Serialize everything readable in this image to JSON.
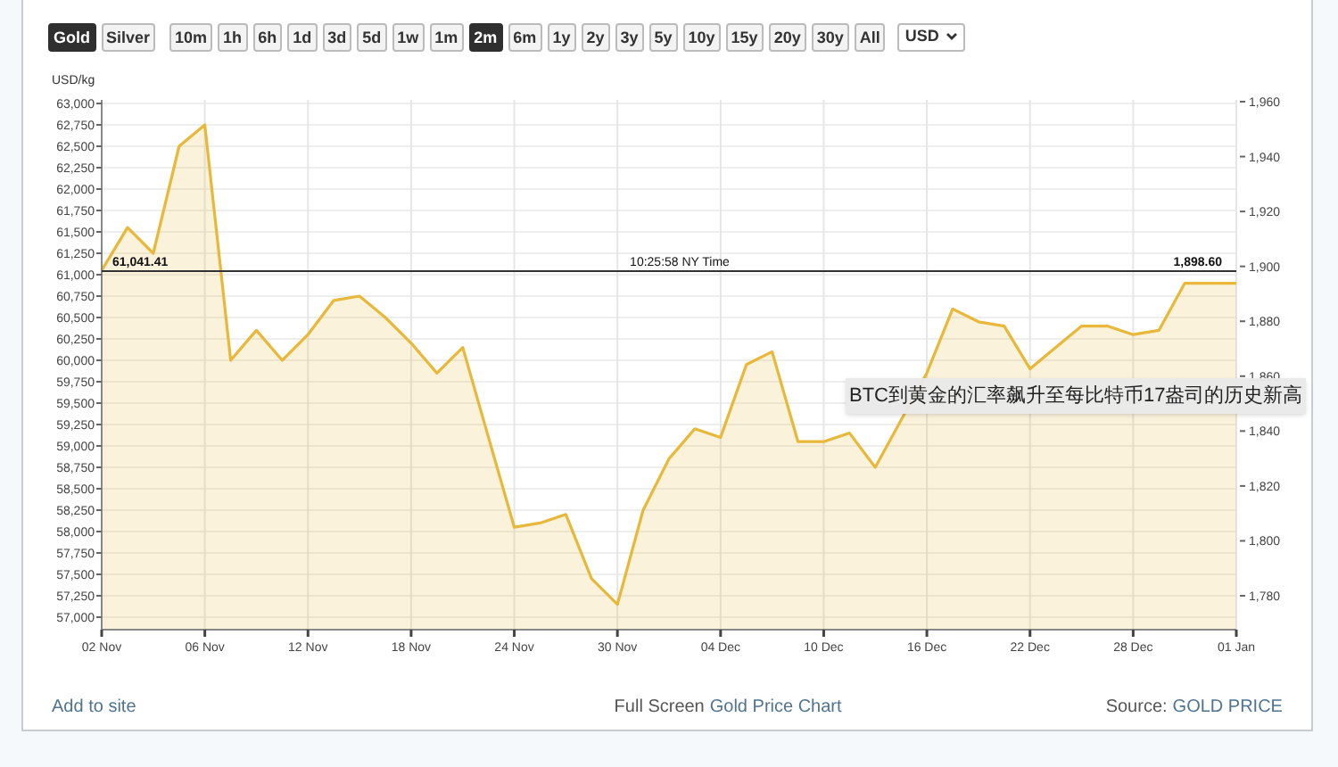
{
  "toolbar": {
    "metals": [
      {
        "label": "Gold",
        "selected": true
      },
      {
        "label": "Silver",
        "selected": false
      }
    ],
    "periods": [
      {
        "label": "10m",
        "selected": false
      },
      {
        "label": "1h",
        "selected": false
      },
      {
        "label": "6h",
        "selected": false
      },
      {
        "label": "1d",
        "selected": false
      },
      {
        "label": "3d",
        "selected": false
      },
      {
        "label": "5d",
        "selected": false
      },
      {
        "label": "1w",
        "selected": false
      },
      {
        "label": "1m",
        "selected": false
      },
      {
        "label": "2m",
        "selected": true
      },
      {
        "label": "6m",
        "selected": false
      },
      {
        "label": "1y",
        "selected": false
      },
      {
        "label": "2y",
        "selected": false
      },
      {
        "label": "3y",
        "selected": false
      },
      {
        "label": "5y",
        "selected": false
      },
      {
        "label": "10y",
        "selected": false
      },
      {
        "label": "15y",
        "selected": false
      },
      {
        "label": "20y",
        "selected": false
      },
      {
        "label": "30y",
        "selected": false
      },
      {
        "label": "All",
        "selected": false
      }
    ],
    "currency": "USD"
  },
  "chart": {
    "chart_data": {
      "type": "area",
      "ylabel": "USD/kg",
      "categories": [
        "02 Nov",
        null,
        null,
        null,
        "06 Nov",
        null,
        null,
        null,
        "12 Nov",
        null,
        null,
        null,
        "18 Nov",
        null,
        null,
        null,
        "24 Nov",
        null,
        null,
        null,
        "30 Nov",
        null,
        null,
        null,
        "04 Dec",
        null,
        null,
        null,
        "10 Dec",
        null,
        null,
        null,
        "16 Dec",
        null,
        null,
        null,
        "22 Dec",
        null,
        null,
        null,
        "28 Dec",
        null,
        null,
        null,
        "01 Jan"
      ],
      "series": [
        {
          "color": "#e8b83a",
          "values": [
            61050,
            61550,
            61250,
            62500,
            62750,
            60000,
            60350,
            60000,
            60300,
            60700,
            60750,
            60500,
            60200,
            59850,
            60150,
            59100,
            58050,
            58100,
            58200,
            57450,
            57150,
            58250,
            58850,
            59200,
            59100,
            59950,
            60100,
            59050,
            59050,
            59150,
            58750,
            null,
            59850,
            60600,
            60450,
            60400,
            59900,
            60150,
            60400,
            60400,
            60300,
            60350,
            60900,
            60900,
            60900
          ]
        }
      ],
      "ylim": [
        56854,
        63042
      ],
      "yticks": [
        {
          "value": 57000,
          "label": "57,000"
        },
        {
          "value": 57250,
          "label": "57,250"
        },
        {
          "value": 57500,
          "label": "57,500"
        },
        {
          "value": 57750,
          "label": "57,750"
        },
        {
          "value": 58000,
          "label": "58,000"
        },
        {
          "value": 58250,
          "label": "58,250"
        },
        {
          "value": 58500,
          "label": "58,500"
        },
        {
          "value": 58750,
          "label": "58,750"
        },
        {
          "value": 59000,
          "label": "59,000"
        },
        {
          "value": 59250,
          "label": "59,250"
        },
        {
          "value": 59500,
          "label": "59,500"
        },
        {
          "value": 59750,
          "label": "59,750"
        },
        {
          "value": 60000,
          "label": "60,000"
        },
        {
          "value": 60250,
          "label": "60,250"
        },
        {
          "value": 60500,
          "label": "60,500"
        },
        {
          "value": 60750,
          "label": "60,750"
        },
        {
          "value": 61000,
          "label": "61,000"
        },
        {
          "value": 61250,
          "label": "61,250"
        },
        {
          "value": 61500,
          "label": "61,500"
        },
        {
          "value": 61750,
          "label": "61,750"
        },
        {
          "value": 62000,
          "label": "62,000"
        },
        {
          "value": 62250,
          "label": "62,250"
        },
        {
          "value": 62500,
          "label": "62,500"
        },
        {
          "value": 62750,
          "label": "62,750"
        },
        {
          "value": 63000,
          "label": "63,000"
        }
      ],
      "grid": true,
      "ref_lines": [
        {
          "axis": "y",
          "value": 61041.41
        }
      ],
      "annotations": [
        {
          "text": "61,041.41",
          "x": "02 Nov",
          "y": 61041.41
        },
        "10:25:58 NY Time",
        {
          "text": "1,898.60",
          "x": "01 Jan",
          "y": 61041.41
        }
      ]
    },
    "right_axis_labels": [
      "1,960",
      "1,940",
      "1,920",
      "1,900",
      "1,880",
      "1,860",
      "1,840",
      "1,820",
      "1,800",
      "1,780"
    ]
  },
  "caption": "BTC到黄金的汇率飙升至每比特币17盎司的历史新高",
  "footer": {
    "left_link": "Add to site",
    "center_text": "Full Screen",
    "center_link": "Gold Price Chart",
    "right_text": "Source:",
    "right_link": "GOLD PRICE"
  }
}
